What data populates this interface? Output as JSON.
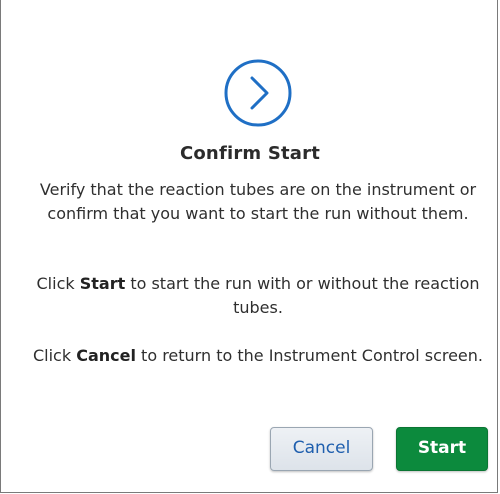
{
  "dialog": {
    "icon": "chevron-right-circle-icon",
    "accent_color": "#1f6fc5",
    "title": "Confirm Start",
    "paragraph1": "Verify that the reaction tubes are on the instrument or confirm that you want to start the run without them.",
    "paragraph2": {
      "prefix": "Click ",
      "bold": "Start",
      "suffix": " to start the run with or without the reaction tubes."
    },
    "paragraph3": {
      "prefix": "Click ",
      "bold": "Cancel",
      "suffix": " to return to the Instrument Control screen."
    },
    "buttons": {
      "cancel_label": "Cancel",
      "start_label": "Start",
      "start_color": "#0c8a3d"
    }
  }
}
